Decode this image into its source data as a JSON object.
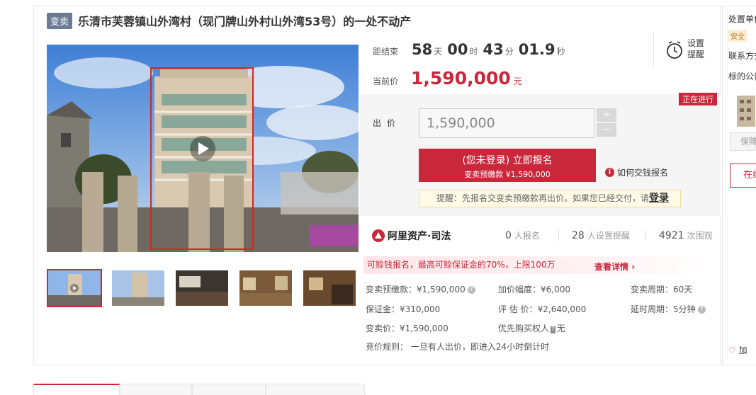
{
  "header": {
    "tag": "变卖",
    "title": "乐清市芙蓉镇山外湾村（现门牌山外村山外湾53号）的一处不动产"
  },
  "countdown": {
    "label": "距结束",
    "days": "58",
    "days_unit": "天",
    "hours": "00",
    "hours_unit": "时",
    "minutes": "43",
    "minutes_unit": "分",
    "seconds": "01.9",
    "seconds_unit": "秒"
  },
  "remind": {
    "label_line1": "设置",
    "label_line2": "提醒"
  },
  "price": {
    "label": "当前价",
    "value": "1,590,000",
    "unit": "元"
  },
  "status": "正在进行",
  "bid": {
    "label": "出价",
    "value": "1,590,000",
    "plus": "+",
    "minus": "−"
  },
  "register_button": {
    "line1": "(您未登录) 立即报名",
    "line2": "变卖预缴款 ¥1,590,000"
  },
  "how_to_pay": "如何交钱报名",
  "notice": {
    "text": "提醒：先报名交变卖预缴款再出价。如果您已经交付，请",
    "link": "登录"
  },
  "platform": {
    "name": "阿里资产·司法"
  },
  "stats": [
    {
      "num": "0",
      "unit": "人报名"
    },
    {
      "num": "28",
      "unit": "人设置提醒"
    },
    {
      "num": "4921",
      "unit": "次围观"
    }
  ],
  "promo": {
    "text": "可赊钱报名，最高可赊保证金的70%，上限100万",
    "link": "查看详情"
  },
  "details": {
    "deposit_prepay": "变卖预缴款：¥1,590,000",
    "increment": "加价幅度：¥6,000",
    "period": "变卖周期：60天",
    "bond": "保证金：¥310,000",
    "appraisal": "评 估 价：¥2,640,000",
    "delay": "延时周期：5分钟",
    "sale_price": "变卖价：¥1,590,000",
    "priority_label": "优先购买权人",
    "priority_badge": "?",
    "priority_value": "无",
    "rules": "竞价规则：  一旦有人出价，即进入24小时倒计时"
  },
  "right_panel": {
    "line1": "处置单位",
    "badge": "安全",
    "line2": "联系方式",
    "line3": "标的公告",
    "btn1": "保障",
    "btn2": "在线",
    "bottom": "加"
  },
  "colors": {
    "accent": "#c9283b",
    "tag_bg": "#6b7b94"
  },
  "icons": [
    "play-icon",
    "clock-icon",
    "info-icon",
    "help-icon",
    "chevron-right-icon",
    "ali-logo-icon"
  ]
}
